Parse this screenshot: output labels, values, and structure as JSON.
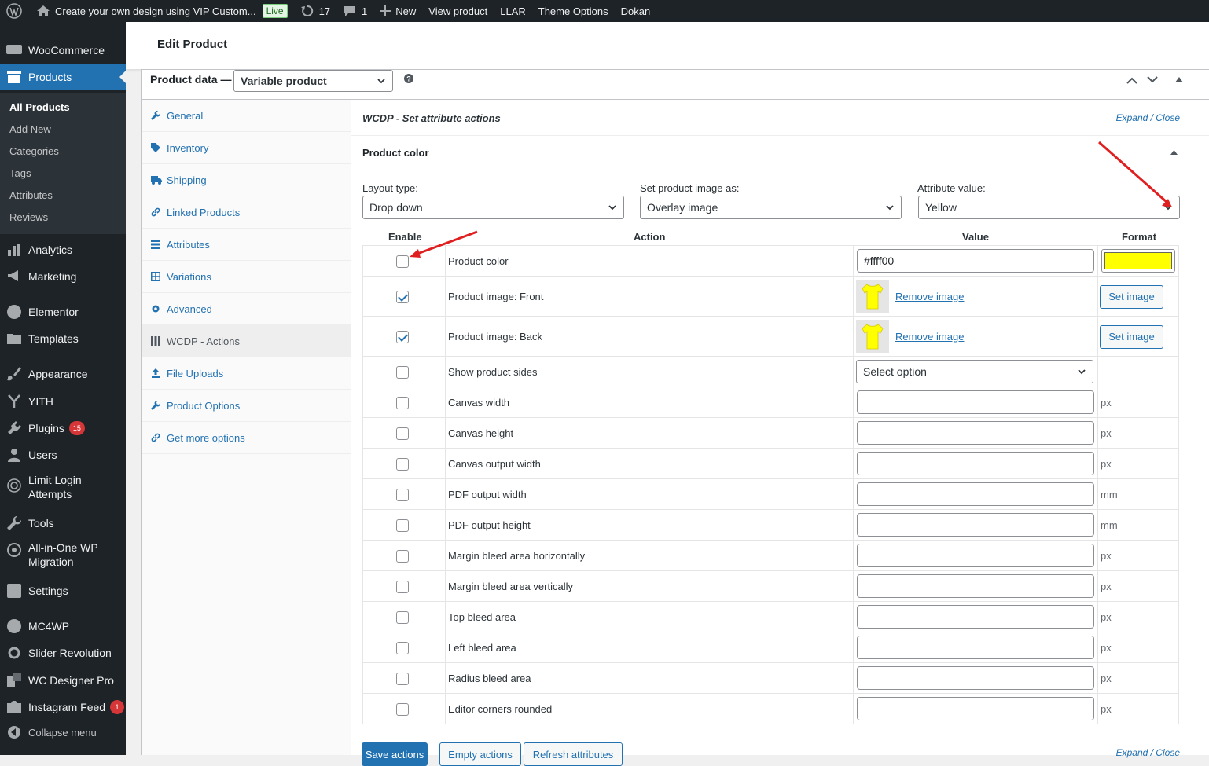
{
  "adminbar": {
    "site_title": "Create your own design using VIP Custom...",
    "live_label": "Live",
    "updates_count": "17",
    "comments_count": "1",
    "new_label": "New",
    "view_product": "View product",
    "llar": "LLAR",
    "theme_options": "Theme Options",
    "dokan": "Dokan"
  },
  "sidebar": {
    "woocommerce": "WooCommerce",
    "products": "Products",
    "sub": [
      "All Products",
      "Add New",
      "Categories",
      "Tags",
      "Attributes",
      "Reviews"
    ],
    "analytics": "Analytics",
    "marketing": "Marketing",
    "elementor": "Elementor",
    "templates": "Templates",
    "appearance": "Appearance",
    "yith": "YITH",
    "plugins": "Plugins",
    "plugins_badge": "15",
    "users": "Users",
    "limit_login_1": "Limit Login",
    "limit_login_2": "Attempts",
    "tools": "Tools",
    "aio_1": "All-in-One WP",
    "aio_2": "Migration",
    "settings": "Settings",
    "mc4wp": "MC4WP",
    "slider_revolution": "Slider Revolution",
    "wc_designer": "WC Designer Pro",
    "instagram": "Instagram Feed",
    "instagram_badge": "1",
    "collapse": "Collapse menu"
  },
  "page": {
    "title": "Edit Product"
  },
  "product_data": {
    "label": "Product data —",
    "type_value": "Variable product",
    "tabs": [
      "General",
      "Inventory",
      "Shipping",
      "Linked Products",
      "Attributes",
      "Variations",
      "Advanced",
      "WCDP - Actions",
      "File Uploads",
      "Product Options",
      "Get more options"
    ]
  },
  "panel": {
    "title": "WCDP - Set attribute actions",
    "expand_close": "Expand / Close",
    "section_title": "Product color",
    "layout_type_label": "Layout type:",
    "layout_type_value": "Drop down",
    "product_image_label": "Set product image as:",
    "product_image_value": "Overlay image",
    "attribute_value_label": "Attribute value:",
    "attribute_value_value": "Yellow",
    "col_enable": "Enable",
    "col_action": "Action",
    "col_value": "Value",
    "col_format": "Format",
    "rows": [
      {
        "label": "Product color",
        "value": "#ffff00",
        "checked": false
      },
      {
        "label": "Product image: Front",
        "link": "Remove image",
        "button": "Set image",
        "checked": true
      },
      {
        "label": "Product image: Back",
        "link": "Remove image",
        "button": "Set image",
        "checked": true
      },
      {
        "label": "Show product sides",
        "select": "Select option",
        "checked": false
      },
      {
        "label": "Canvas width",
        "unit": "px"
      },
      {
        "label": "Canvas height",
        "unit": "px"
      },
      {
        "label": "Canvas output width",
        "unit": "px"
      },
      {
        "label": "PDF output width",
        "unit": "mm"
      },
      {
        "label": "PDF output height",
        "unit": "mm"
      },
      {
        "label": "Margin bleed area horizontally",
        "unit": "px"
      },
      {
        "label": "Margin bleed area vertically",
        "unit": "px"
      },
      {
        "label": "Top bleed area",
        "unit": "px"
      },
      {
        "label": "Left bleed area",
        "unit": "px"
      },
      {
        "label": "Radius bleed area",
        "unit": "px"
      },
      {
        "label": "Editor corners rounded",
        "unit": "px"
      }
    ],
    "save_actions": "Save actions",
    "empty_actions": "Empty actions",
    "refresh_attributes": "Refresh attributes"
  },
  "colors": {
    "accent": "#2271b1",
    "swatch": "#ffff00",
    "arrow": "#e02020"
  }
}
